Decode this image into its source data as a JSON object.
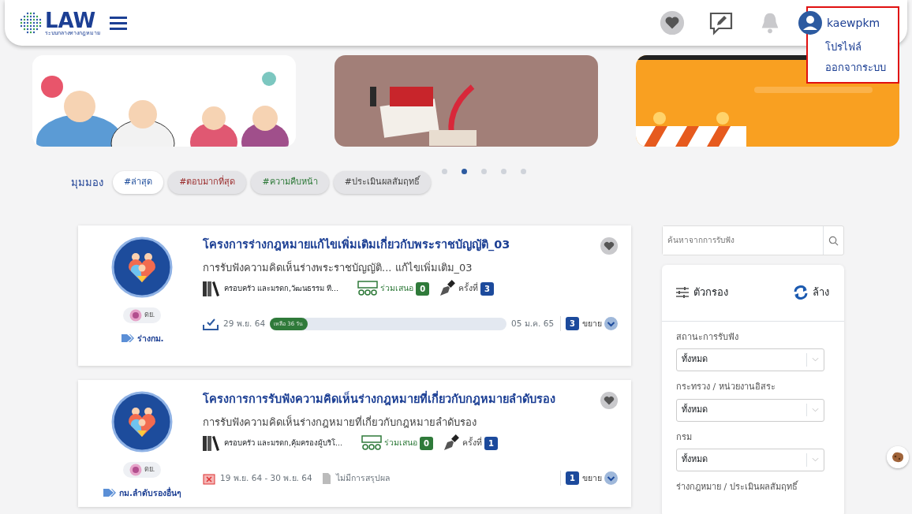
{
  "header": {
    "logo": "LAW",
    "logo_subtitle": "ระบบกลางทางกฎหมาย",
    "user": "kaewpkm",
    "user_menu": [
      "โปรไฟล์",
      "ออกจากระบบ"
    ]
  },
  "carousel_dots": [
    {
      "selected": false
    },
    {
      "selected": true
    },
    {
      "selected": false
    },
    {
      "selected": false
    },
    {
      "selected": false
    }
  ],
  "view_tags": {
    "label": "มุมมอง",
    "tags": [
      {
        "label": "#ล่าสุด",
        "selected": true,
        "color": "#1f4e9c"
      },
      {
        "label": "#ตอบมากที่สุด",
        "selected": false,
        "color": "#9c2f2f"
      },
      {
        "label": "#ความคืบหน้า",
        "selected": false,
        "color": "#2f7a3a"
      },
      {
        "label": "#ประเมินผลสัมฤทธิ์",
        "selected": false,
        "color": "#444444"
      }
    ]
  },
  "cards": [
    {
      "kind": "open",
      "title": "โครงการร่างกฎหมายแก้ไขเพิ่มเติมเกี่ยวกับพระราชบัญญัติ_03",
      "description": "การรับฟังความคิดเห็นร่างพระราชบัญญัติ... แก้ไขเพิ่มเติม_03",
      "agency": "ดย.",
      "category": "ร่างกม.",
      "topics": "ครอบครัว และมรดก,วัฒนธรรม ที...",
      "participate_label": "ร่วมเสนอ",
      "participate_count": "0",
      "round_label": "ครั้งที่",
      "round": "3",
      "start_date": "29 พ.ย. 64",
      "progress": {
        "label": "เหลือ 36 วัน",
        "level": 0.16
      },
      "end_date": "05 ม.ค. 65",
      "count": "3",
      "expand": "ขยาย"
    },
    {
      "kind": "closed",
      "title": "โครงการการรับฟังความคิดเห็นร่างกฎหมายที่เกี่ยวกับกฎหมายลำดับรอง",
      "description": "การรับฟังความคิดเห็นร่างกฎหมายที่เกี่ยวกับกฎหมายลำดับรอง",
      "agency": "ดย.",
      "category": "กม.ลำดับรองอื่นๆ",
      "topics": "ครอบครัว และมรดก,คุ้มครองผู้บริโ...",
      "participate_label": "ร่วมเสนอ",
      "participate_count": "0",
      "round_label": "ครั้งที่",
      "round": "1",
      "date_range": "19 พ.ย. 64 - 30 พ.ย. 64",
      "summary": "ไม่มีการสรุปผล",
      "count": "1",
      "expand": "ขยาย"
    }
  ],
  "sidebar": {
    "search_placeholder": "ค้นหาจากการรับฟัง",
    "filter_title": "ตัวกรอง",
    "reset": "ล้าง",
    "fields": [
      {
        "label": "สถานะการรับฟัง",
        "value": "ทั้งหมด"
      },
      {
        "label": "กระทรวง / หน่วยงานอิสระ",
        "value": "ทั้งหมด"
      },
      {
        "label": "กรม",
        "value": "ทั้งหมด"
      },
      {
        "label": "ร่างกฎหมาย / ประเมินผลสัมฤทธิ์"
      }
    ]
  }
}
